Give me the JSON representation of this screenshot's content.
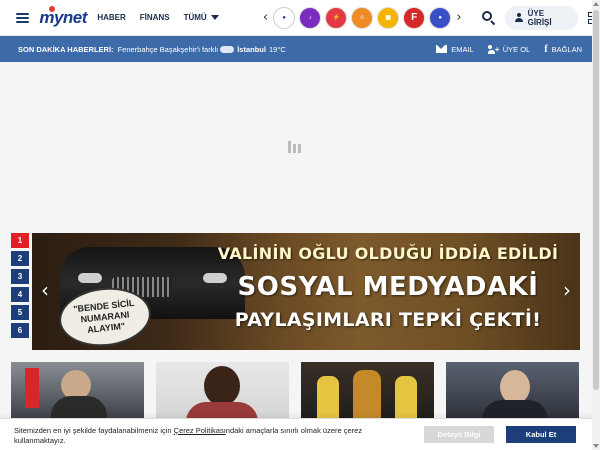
{
  "header": {
    "logo_text": "mynet",
    "nav": [
      {
        "label": "HABER"
      },
      {
        "label": "FİNANS"
      },
      {
        "label": "TÜMÜ"
      }
    ],
    "brands": [
      {
        "icon": "mynet-logo-icon",
        "color": "#1c3f7a",
        "text": "mynet"
      },
      {
        "icon": "microphone-icon",
        "color": "#7b2cbf",
        "text": ""
      },
      {
        "icon": "lightning-icon",
        "color": "#e63946",
        "text": ""
      },
      {
        "icon": "chef-icon",
        "color": "#f08a24",
        "text": ""
      },
      {
        "icon": "shopping-bag-icon",
        "color": "#f4b400",
        "text": ""
      },
      {
        "icon": "f-logo-icon",
        "color": "#d62828",
        "text": "F"
      },
      {
        "icon": "blue-brand-icon",
        "color": "#3a4fc6",
        "text": ""
      }
    ],
    "login_label": "ÜYE GİRİŞİ"
  },
  "breaking": {
    "label": "SON DAKİKA HABERLERİ:",
    "headline": "Fenerbahçe Başakşehir'i farklı",
    "city": "İstanbul",
    "temperature": "19°C",
    "links": [
      {
        "label": "EMAIL",
        "icon": "mail-icon"
      },
      {
        "label": "ÜYE OL",
        "icon": "add-user-icon"
      },
      {
        "label": "BAĞLAN",
        "icon": "facebook-icon"
      }
    ]
  },
  "slider": {
    "numbers": [
      "1",
      "2",
      "3",
      "4",
      "5",
      "6"
    ],
    "active_index": 0,
    "hero": {
      "line1": "VALİNİN OĞLU OLDUĞU İDDİA EDİLDİ",
      "line2": "SOSYAL MEDYADAKİ",
      "line3": "PAYLAŞIMLARI TEPKİ ÇEKTİ!",
      "bubble": [
        "\"BENDE SİCİL",
        "NUMARANI",
        "ALAYIM\""
      ]
    }
  },
  "cards": [
    {
      "caption": "",
      "color_top": "#8a8f96",
      "color_bottom": "#2c2f33",
      "icon": "flag-icon"
    },
    {
      "caption": "",
      "color_top": "#9a3b3b",
      "color_bottom": "#e8e8e8",
      "icon": "player-icon"
    },
    {
      "caption": "",
      "color_top": "#c48a2a",
      "color_bottom": "#1a1a1a",
      "icon": "basketball-icon"
    },
    {
      "caption": "",
      "color_top": "#5a6270",
      "color_bottom": "#1f2228",
      "icon": "politician-icon"
    }
  ],
  "cookie": {
    "text_before": "Sitemizden en iyi şekilde faydalanabilmeniz için ",
    "link": "Çerez Politikası",
    "text_after": "ndaki amaçlarla sınırlı olmak üzere çerez kullanmaktayız.",
    "detail_label": "Detaylı Bilgi",
    "accept_label": "Kabul Et"
  }
}
